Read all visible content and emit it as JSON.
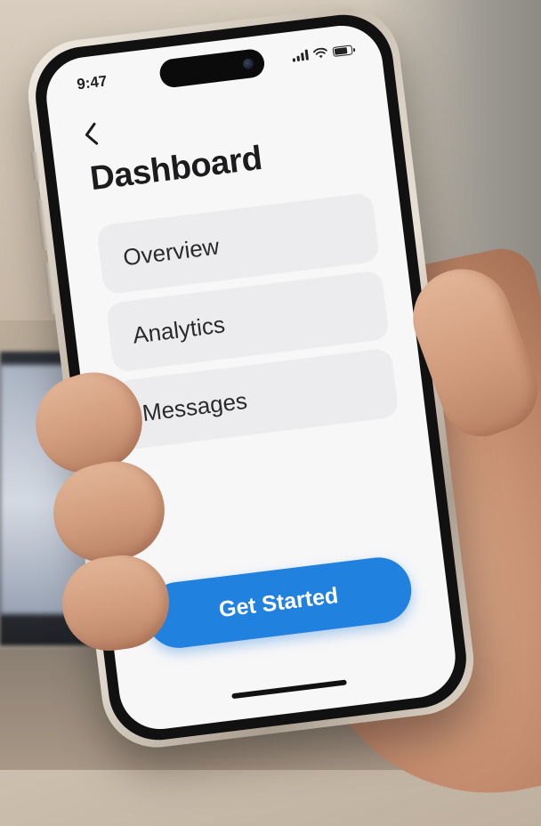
{
  "status_bar": {
    "time": "9:47",
    "battery_level": 0.85
  },
  "header": {
    "back_icon": "chevron-left-icon",
    "title": "Dashboard"
  },
  "menu": {
    "items": [
      {
        "label": "Overview"
      },
      {
        "label": "Analytics"
      },
      {
        "label": "Messages"
      }
    ]
  },
  "cta": {
    "label": "Get Started",
    "color": "#2181DE"
  }
}
